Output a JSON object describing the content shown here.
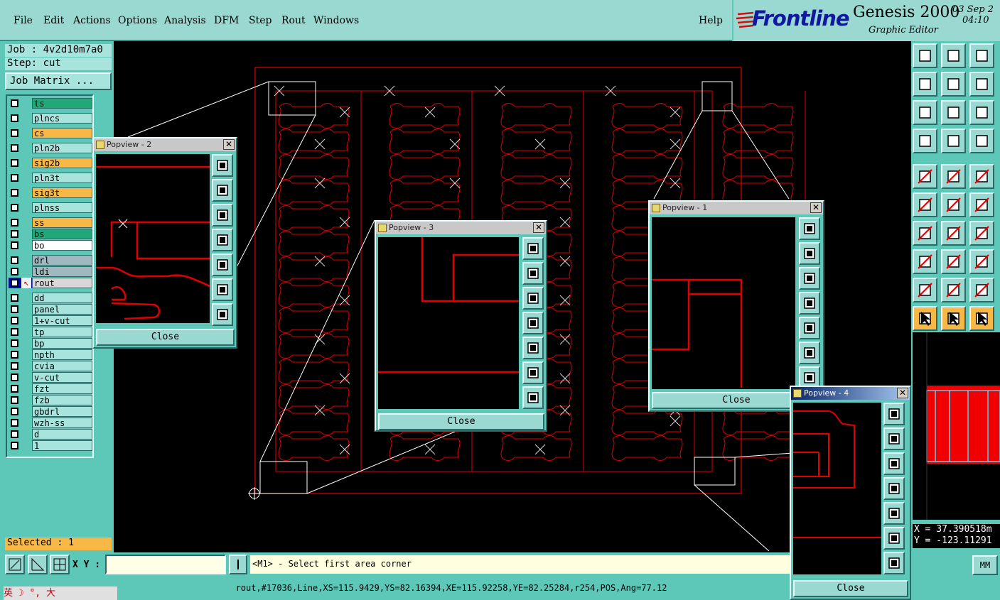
{
  "menu": [
    "File",
    "Edit",
    "Actions",
    "Options",
    "Analysis",
    "DFM",
    "Step",
    "Rout",
    "Windows"
  ],
  "help": "Help",
  "brand": {
    "logo": "Frontline",
    "product": "Genesis 2000",
    "subtitle": "Graphic Editor",
    "date": "03 Sep 2",
    "time": "04:10"
  },
  "job": {
    "job_label": "Job : 4v2d10m7a0",
    "step_label": "Step: cut",
    "matrix_button": "Job Matrix ..."
  },
  "layers": [
    {
      "name": "ts",
      "color": "#20a878"
    },
    {
      "name": "plncs",
      "color": "#a8e4de"
    },
    {
      "name": "cs",
      "color": "#f8b848"
    },
    {
      "name": "pln2b",
      "color": "#a8e4de"
    },
    {
      "name": "sig2b",
      "color": "#f8b848"
    },
    {
      "name": "pln3t",
      "color": "#a8e4de"
    },
    {
      "name": "sig3t",
      "color": "#f8b848"
    },
    {
      "name": "plnss",
      "color": "#a8e4de"
    },
    {
      "name": "ss",
      "color": "#f8b848"
    },
    {
      "name": "bs",
      "color": "#20a878"
    },
    {
      "name": "bo",
      "color": "#ffffff"
    },
    {
      "name": "drl",
      "color": "#a0b8c0"
    },
    {
      "name": "ldi",
      "color": "#a0b8c0"
    },
    {
      "name": "rout",
      "color": "#d8d8d8"
    },
    {
      "name": "dd",
      "color": "#a8e4de"
    },
    {
      "name": "panel",
      "color": "#a8e4de"
    },
    {
      "name": "1+v-cut",
      "color": "#a8e4de"
    },
    {
      "name": "tp",
      "color": "#a8e4de"
    },
    {
      "name": "bp",
      "color": "#a8e4de"
    },
    {
      "name": "npth",
      "color": "#a8e4de"
    },
    {
      "name": "cvia",
      "color": "#a8e4de"
    },
    {
      "name": "v-cut",
      "color": "#a8e4de"
    },
    {
      "name": "fzt",
      "color": "#a8e4de"
    },
    {
      "name": "fzb",
      "color": "#a8e4de"
    },
    {
      "name": "gbdrl",
      "color": "#a8e4de"
    },
    {
      "name": "wzh-ss",
      "color": "#a8e4de"
    },
    {
      "name": "d",
      "color": "#a8e4de"
    },
    {
      "name": "1",
      "color": "#a8e4de"
    }
  ],
  "selected": "Selected : 1",
  "xy_label": "X Y :",
  "xy_value": "",
  "prompt": "<M1> - Select first area corner",
  "status_line": "rout,#17036,Line,XS=115.9429,YS=82.16394,XE=115.92258,YE=82.25284,r254,POS,Ang=77.12",
  "coords": {
    "x": "X = 37.390518m",
    "y": "Y = -123.11291"
  },
  "units": "MM",
  "ime": "英 ☽ °, 大",
  "popups": [
    {
      "title": "Popview - 2",
      "close": "Close"
    },
    {
      "title": "Popview - 3",
      "close": "Close"
    },
    {
      "title": "Popview - 1",
      "close": "Close"
    },
    {
      "title": "Popview - 4",
      "close": "Close"
    }
  ],
  "colors": {
    "background": "#5ec8b8",
    "panel_button": "#9ad8d2",
    "rout": "#e00000",
    "canvas": "#000000",
    "selected_bar": "#f8b848"
  }
}
